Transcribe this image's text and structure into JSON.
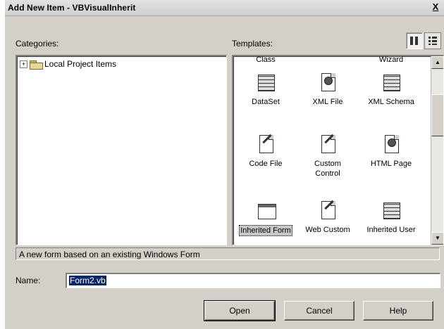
{
  "window": {
    "title": "Add New Item - VBVisualInherit",
    "close": "X"
  },
  "categories": {
    "label": "Categories:",
    "tree": [
      {
        "expander": "+",
        "label": "Local Project Items"
      }
    ]
  },
  "templates": {
    "label": "Templates:",
    "view_buttons": [
      "large-icons",
      "list"
    ],
    "items": [
      {
        "label": "Class",
        "icon": "class-icon"
      },
      {
        "label": "Wizard",
        "icon": "wizard-icon"
      },
      {
        "label": "DataSet",
        "icon": "dataset-icon"
      },
      {
        "label": "XML File",
        "icon": "xml-file-icon"
      },
      {
        "label": "XML Schema",
        "icon": "xml-schema-icon"
      },
      {
        "label": "Code File",
        "icon": "code-file-icon"
      },
      {
        "label": "Custom Control",
        "icon": "custom-control-icon",
        "lines": [
          "Custom",
          "Control"
        ]
      },
      {
        "label": "HTML Page",
        "icon": "html-page-icon"
      },
      {
        "label": "Inherited Form",
        "icon": "inherited-form-icon",
        "selected": true
      },
      {
        "label": "Web Custom",
        "icon": "web-custom-icon"
      },
      {
        "label": "Inherited User",
        "icon": "inherited-user-icon"
      }
    ]
  },
  "description": "A new form based on an existing Windows Form",
  "name_field": {
    "label": "Name:",
    "value": "Form2.vb"
  },
  "buttons": {
    "open": "Open",
    "cancel": "Cancel",
    "help": "Help"
  }
}
